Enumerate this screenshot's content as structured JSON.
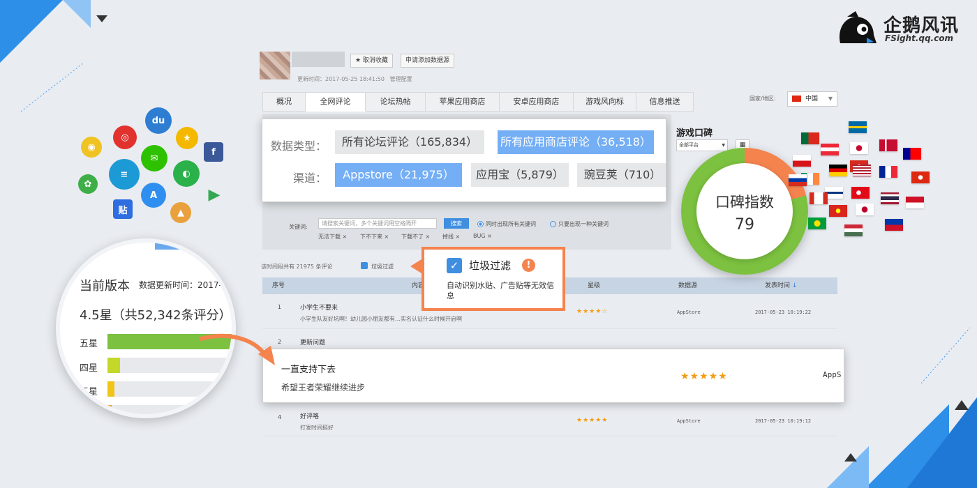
{
  "brand": {
    "name": "企鹅风讯",
    "url": "FSight.qq.com",
    "icon": "penguin-logo-icon"
  },
  "app_icons": [
    {
      "name": "weibo-icon",
      "glyph": "◉",
      "color": "#f0c324"
    },
    {
      "name": "netease-icon",
      "glyph": "◎",
      "color": "#e2322d"
    },
    {
      "name": "baidu-icon",
      "glyph": "du",
      "color": "#2d7dd2"
    },
    {
      "name": "qzone-icon",
      "glyph": "★",
      "color": "#f5b800"
    },
    {
      "name": "facebook-icon",
      "glyph": "f",
      "color": "#3b5998"
    },
    {
      "name": "wechat-icon",
      "glyph": "✉",
      "color": "#2dc100"
    },
    {
      "name": "tencent-games-icon",
      "glyph": "≡",
      "color": "#1c9ad6"
    },
    {
      "name": "app-store-icon",
      "glyph": "A",
      "color": "#2f8ff0"
    },
    {
      "name": "360-icon",
      "glyph": "◐",
      "color": "#2bb14a"
    },
    {
      "name": "android-market-icon",
      "glyph": "✿",
      "color": "#3fae49"
    },
    {
      "name": "google-play-icon",
      "glyph": "▶",
      "color": "#34a853"
    },
    {
      "name": "tieba-icon",
      "glyph": "贴",
      "color": "#2f6ee0"
    },
    {
      "name": "app-china-icon",
      "glyph": "▲",
      "color": "#e8a13c"
    }
  ],
  "header": {
    "unfavorite_label": "★ 取消收藏",
    "request_source_label": "申请添加数据源",
    "update_time": "更新时间：2017-05-25 18:41:50",
    "manage_label": "管理配置"
  },
  "tabs": [
    "概况",
    "全网评论",
    "论坛热帖",
    "苹果应用商店",
    "安卓应用商店",
    "游戏风向标",
    "信息推送"
  ],
  "active_tab": "全网评论",
  "region": {
    "label": "国家/地区:",
    "value": "中国"
  },
  "filters": {
    "keyword_label": "关键词:",
    "keyword_placeholder": "请搜索关键词，多个关键词用空格隔开",
    "search_label": "搜索",
    "mode_all": "同时出现所有关键词",
    "mode_any": "只要出现一种关键词",
    "chips": [
      "无法下载 ×",
      "下不下来 ×",
      "下载不了 ×",
      "掉线 ×",
      "BUG ×"
    ]
  },
  "result_count": "该时间段共有 21975 条评论",
  "spam_filter_small": "垃圾过滤",
  "table": {
    "headers": [
      "序号",
      "内容",
      "星级",
      "数据源",
      "发表时间"
    ],
    "sort_icon": "sort-down-icon",
    "rows": [
      {
        "num": "1",
        "title": "小学生不要来",
        "body": "小学生队友好坑啊！幼儿园小朋友都有…实名认证什么时候开启啊",
        "stars": "★★★★☆",
        "source": "AppStore",
        "time": "2017-05-23 10:19:22"
      },
      {
        "num": "2",
        "title": "更新问题",
        "body": "",
        "stars": "",
        "source": "",
        "time": ""
      },
      {
        "num": "4",
        "title": "好评咯",
        "body": "打发时间挺好",
        "stars": "★★★★★",
        "source": "AppStore",
        "time": "2017-05-23 10:19:12"
      }
    ]
  },
  "data_type_card": {
    "data_type_label": "数据类型：",
    "forum_reviews": "所有论坛评论（165,834）",
    "store_reviews": "所有应用商店评论（36,518）",
    "channel_label": "渠道：",
    "appstore": "Appstore（21,975）",
    "yingyongbao": "应用宝（5,879）",
    "wandoujia": "豌豆荚（710）"
  },
  "spam_card": {
    "title": "垃圾过滤",
    "warn": "!",
    "description": "自动识别水贴、广告贴等无效信息"
  },
  "highlight_row": {
    "title": "一直支持下去",
    "body": "希望王者荣耀继续进步",
    "stars": "★★★★★",
    "source": "AppS"
  },
  "version_card": {
    "title": "当前版本",
    "meta": "数据更新时间：2017-",
    "score": "4.5星（共52,342条评分）",
    "ratings": [
      {
        "label": "五星",
        "fraction": 0.9,
        "color": "#7cc13f"
      },
      {
        "label": "四星",
        "fraction": 0.09,
        "color": "#c4d82a"
      },
      {
        "label": "三星",
        "fraction": 0.05,
        "color": "#f0c419"
      }
    ]
  },
  "reputation": {
    "title": "游戏口碑",
    "platform": "全部平台",
    "label": "口碑指数",
    "value": "79",
    "score_fraction": 0.79,
    "colors": {
      "positive": "#7cc13f",
      "negative": "#f4834e"
    }
  },
  "flags": [
    "Portugal",
    "Sweden",
    "Austria",
    "South Korea",
    "Denmark",
    "Czech Republic",
    "Switzerland",
    "Taiwan",
    "Ireland",
    "Germany",
    "USA",
    "France",
    "Hong Kong",
    "Finland",
    "Turkey",
    "Thailand",
    "Indonesia",
    "Brazil",
    "Vietnam",
    "Japan",
    "Hungary",
    "Philippines",
    "Russia",
    "Canada"
  ]
}
